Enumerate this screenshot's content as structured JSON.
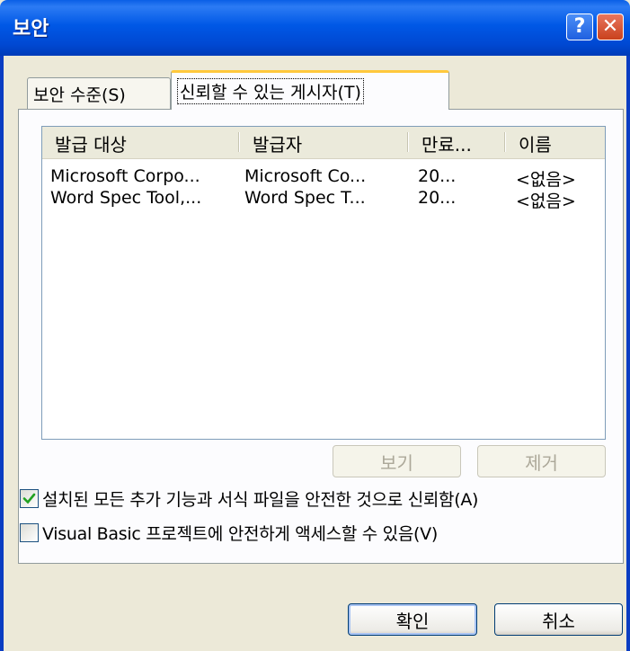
{
  "window": {
    "title": "보안",
    "help_glyph": "?",
    "close_glyph": "✕"
  },
  "tabs": [
    {
      "label": "보안 수준(S)",
      "selected": false
    },
    {
      "label": "신뢰할 수 있는 게시자(T)",
      "selected": true
    }
  ],
  "publishers_list": {
    "columns": [
      "발급 대상",
      "발급자",
      "만료...",
      "이름"
    ],
    "rows": [
      [
        "Microsoft Corpo...",
        "Microsoft Co...",
        "20...",
        "<없음>"
      ],
      [
        "Word Spec Tool,...",
        "Word Spec T...",
        "20...",
        "<없음>"
      ]
    ]
  },
  "list_buttons": {
    "view_label": "보기",
    "remove_label": "제거"
  },
  "options": {
    "trust_addins_label": "설치된 모든 추가 기능과 서식 파일을 안전한 것으로 신뢰함(A)",
    "trust_addins_checked": true,
    "trust_vba_label": "Visual Basic 프로젝트에 안전하게 액세스할 수 있음(V)",
    "trust_vba_checked": false
  },
  "dialog_buttons": {
    "ok_label": "확인",
    "cancel_label": "취소"
  },
  "colors": {
    "titlebar": "#0058E6",
    "dialog_bg": "#ECE9D8",
    "selected_tab_accent": "#FFC83C",
    "check_mark": "#21A121"
  }
}
